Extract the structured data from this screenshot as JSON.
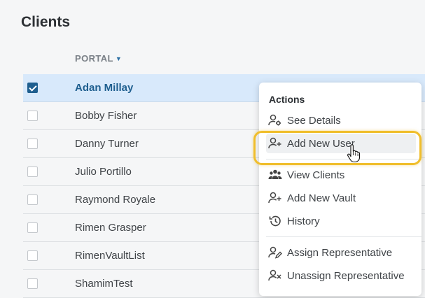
{
  "page": {
    "title": "Clients"
  },
  "table": {
    "column_header": "PORTAL",
    "rows": [
      {
        "name": "Adan Millay",
        "checked": true
      },
      {
        "name": "Bobby Fisher",
        "checked": false
      },
      {
        "name": "Danny Turner",
        "checked": false
      },
      {
        "name": "Julio Portillo",
        "checked": false
      },
      {
        "name": "Raymond Royale",
        "checked": false
      },
      {
        "name": "Rimen Grasper",
        "checked": false
      },
      {
        "name": "RimenVaultList",
        "checked": false
      },
      {
        "name": "ShamimTest",
        "checked": false
      }
    ]
  },
  "actions_menu": {
    "title": "Actions",
    "items": [
      {
        "label": "See Details",
        "icon": "user-gear-icon"
      },
      {
        "label": "Add New User",
        "icon": "user-plus-icon"
      },
      {
        "label": "View Clients",
        "icon": "users-group-icon"
      },
      {
        "label": "Add New Vault",
        "icon": "user-plus-icon"
      },
      {
        "label": "History",
        "icon": "history-icon"
      },
      {
        "label": "Assign Representative",
        "icon": "user-edit-icon"
      },
      {
        "label": "Unassign Representative",
        "icon": "user-x-icon"
      }
    ]
  },
  "colors": {
    "accent": "#1f5f8f",
    "selected_row": "#d8e9fb",
    "focus_ring": "#f0be2c",
    "background": "#f5f6f7"
  }
}
